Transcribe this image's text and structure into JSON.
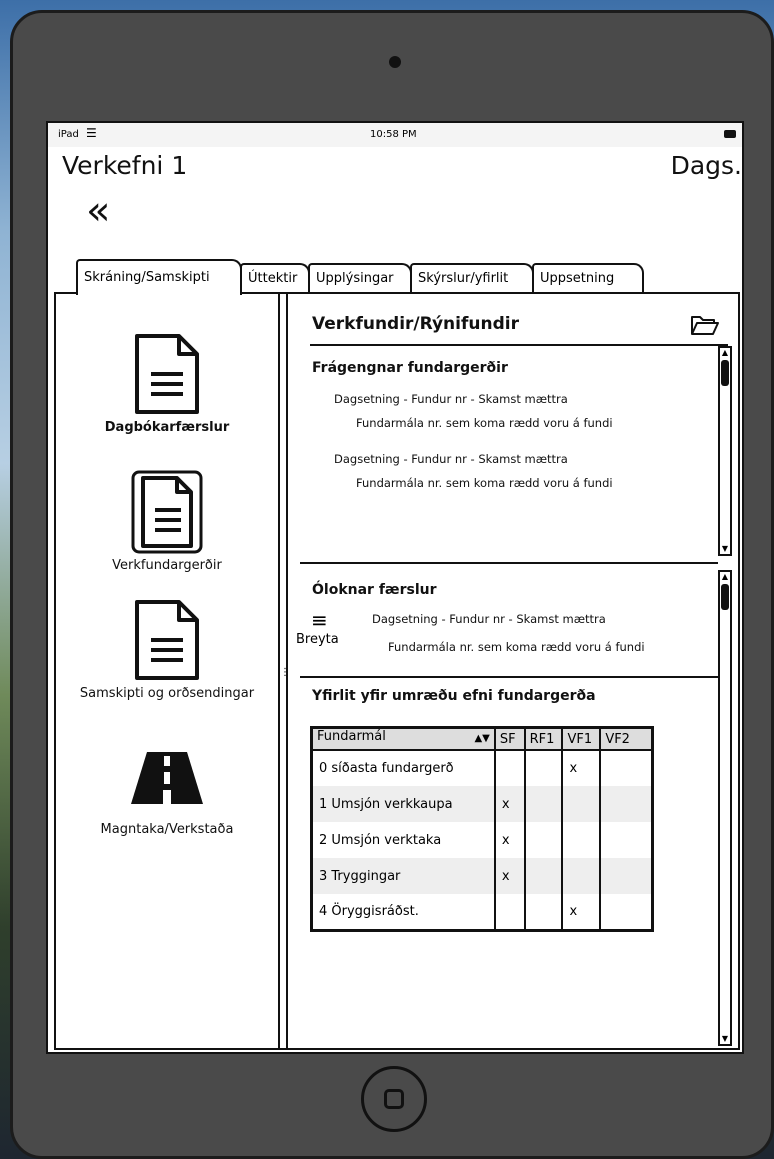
{
  "statusbar": {
    "carrier": "iPad",
    "time": "10:58 PM"
  },
  "header": {
    "title": "Verkefni 1",
    "date_label": "Dags."
  },
  "tabs": [
    "Skráning/Samskipti",
    "Úttektir",
    "Upplýsingar",
    "Skýrslur/yfirlit",
    "Uppsetning"
  ],
  "active_tab": "Skráning/Samskipti",
  "sidebar": {
    "items": [
      {
        "label": "Dagbókarfærslur",
        "icon": "document-icon"
      },
      {
        "label": "Verkfundargerðir",
        "icon": "document-icon"
      },
      {
        "label": "Samskipti og orðsendingar",
        "icon": "document-icon"
      },
      {
        "label": "Magntaka/Verkstaða",
        "icon": "road-icon"
      }
    ]
  },
  "main": {
    "title": "Verkfundir/Rýnifundir",
    "past_minutes": {
      "title": "Frágengnar fundargerðir",
      "entries": [
        {
          "line1": "Dagsetning - Fundur nr - Skamst mættra",
          "line2": "Fundarmála nr. sem koma rædd voru á fundi"
        },
        {
          "line1": "Dagsetning - Fundur nr - Skamst mættra",
          "line2": "Fundarmála nr. sem koma rædd voru á fundi"
        }
      ]
    },
    "open_entries": {
      "title": "Óloknar færslur",
      "edit_label": "Breyta",
      "line1": "Dagsetning - Fundur nr - Skamst mættra",
      "line2": "Fundarmála nr. sem koma rædd voru á fundi"
    },
    "summary": {
      "title": "Yfirlit yfir umræðu efni fundargerða",
      "columns": [
        "Fundarmál",
        "SF",
        "RF1",
        "VF1",
        "VF2"
      ],
      "rows": [
        [
          "0 síðasta fundargerð",
          "",
          "",
          "x",
          ""
        ],
        [
          "1 Umsjón verkkaupa",
          "x",
          "",
          "",
          ""
        ],
        [
          "2 Umsjón verktaka",
          "x",
          "",
          "",
          ""
        ],
        [
          "3 Tryggingar",
          "x",
          "",
          "",
          ""
        ],
        [
          "4 Öryggisráðst.",
          "",
          "",
          "x",
          ""
        ]
      ]
    }
  }
}
